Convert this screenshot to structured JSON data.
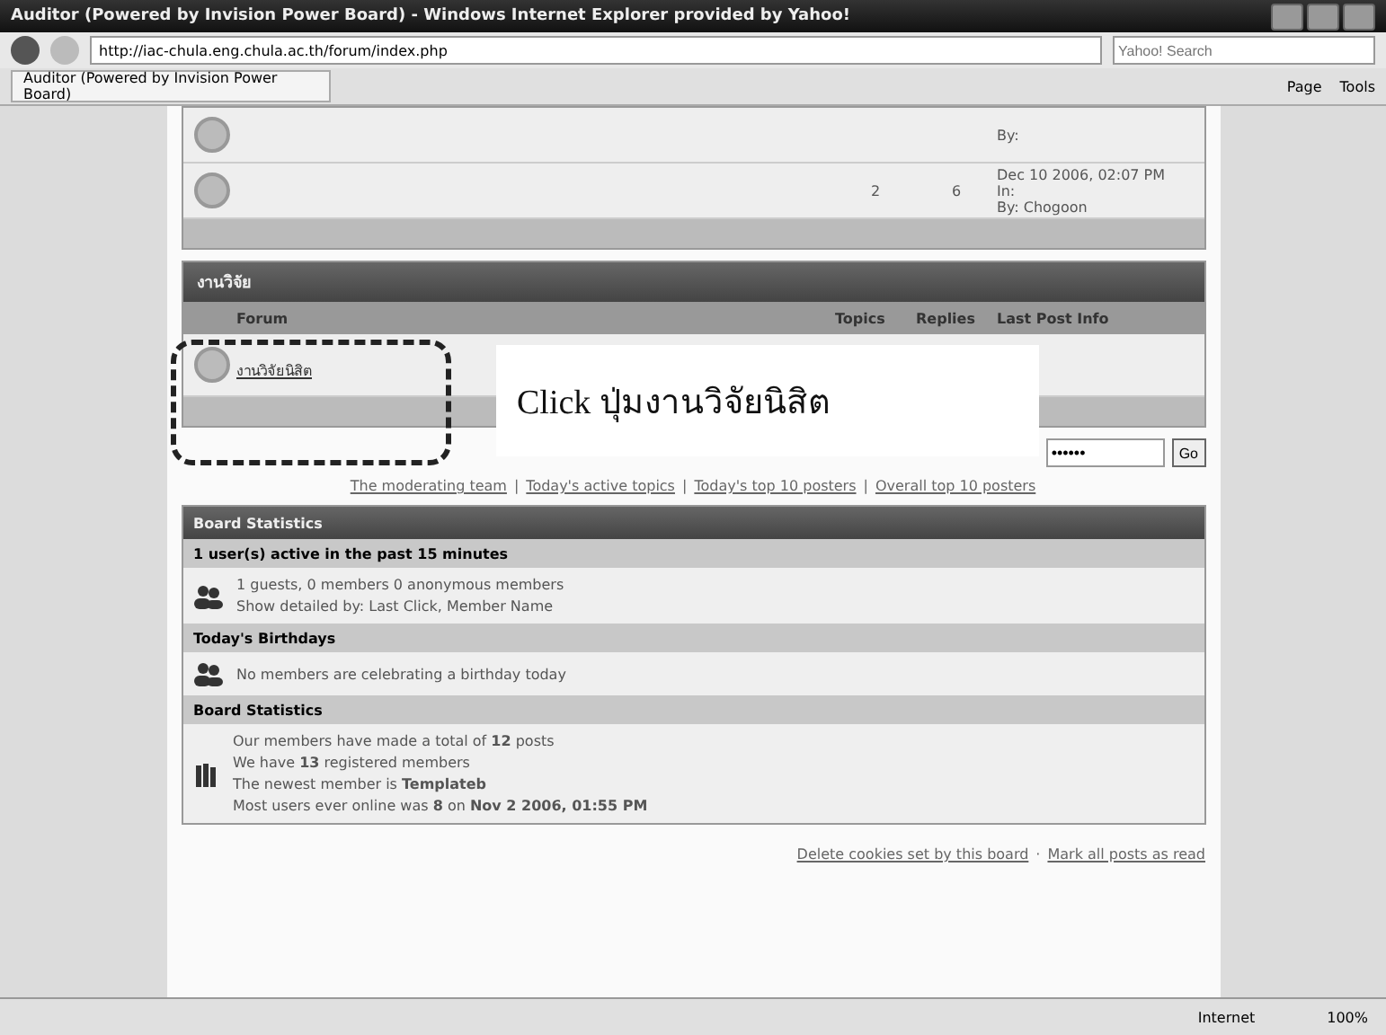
{
  "window": {
    "title": "Auditor (Powered by Invision Power Board) - Windows Internet Explorer provided by Yahoo!"
  },
  "address_bar": {
    "url": "http://iac-chula.eng.chula.ac.th/forum/index.php",
    "search_placeholder": "Yahoo! Search"
  },
  "tab": {
    "label": "Auditor (Powered by Invision Power Board)",
    "selected": true
  },
  "command_bar": [
    "Page",
    "Tools"
  ],
  "top_forums": [
    {
      "last_post": [
        "By:"
      ]
    },
    {
      "last_post": [
        "Dec 10 2006, 02:07 PM",
        "In: ",
        "By: Chogoon"
      ],
      "topics": "2",
      "replies": "6"
    }
  ],
  "category": {
    "title": "งานวิจัย",
    "columns": [
      "Forum",
      "Topics",
      "Replies",
      "Last Post Info"
    ],
    "forums": [
      {
        "title": "งานวิจัยนิสิต"
      }
    ]
  },
  "callout": {
    "text": "Click ปุ่มงานวิจัยนิสิต"
  },
  "login": {
    "password": "••••••",
    "button": "Go"
  },
  "quick_links_separator": "|",
  "footer_separator": "·",
  "quick_links": [
    "The moderating team",
    "Today's active topics",
    "Today's top 10 posters",
    "Overall top 10 posters"
  ],
  "stats": {
    "title": "Board Statistics",
    "sections": [
      {
        "heading": "1 user(s) active in the past 15 minutes",
        "kind": "users",
        "lines": [
          "1 guests, 0 members 0 anonymous members",
          "Show detailed by: Last Click, Member Name"
        ]
      },
      {
        "heading": "Today's Birthdays",
        "kind": "users",
        "lines": [
          "No members are celebrating a birthday today"
        ]
      },
      {
        "heading": "Board Statistics",
        "kind": "books",
        "lines": [
          "Our members have made a total of **12** posts",
          "We have **13** registered members",
          "The newest member is **Templateb**",
          "Most users ever online was **8** on **Nov 2 2006, 01:55 PM**"
        ]
      }
    ]
  },
  "footer_links": [
    "Delete cookies set by this board",
    "Mark all posts as read"
  ],
  "status_bar": {
    "zone": "Internet",
    "zoom": "100%"
  }
}
